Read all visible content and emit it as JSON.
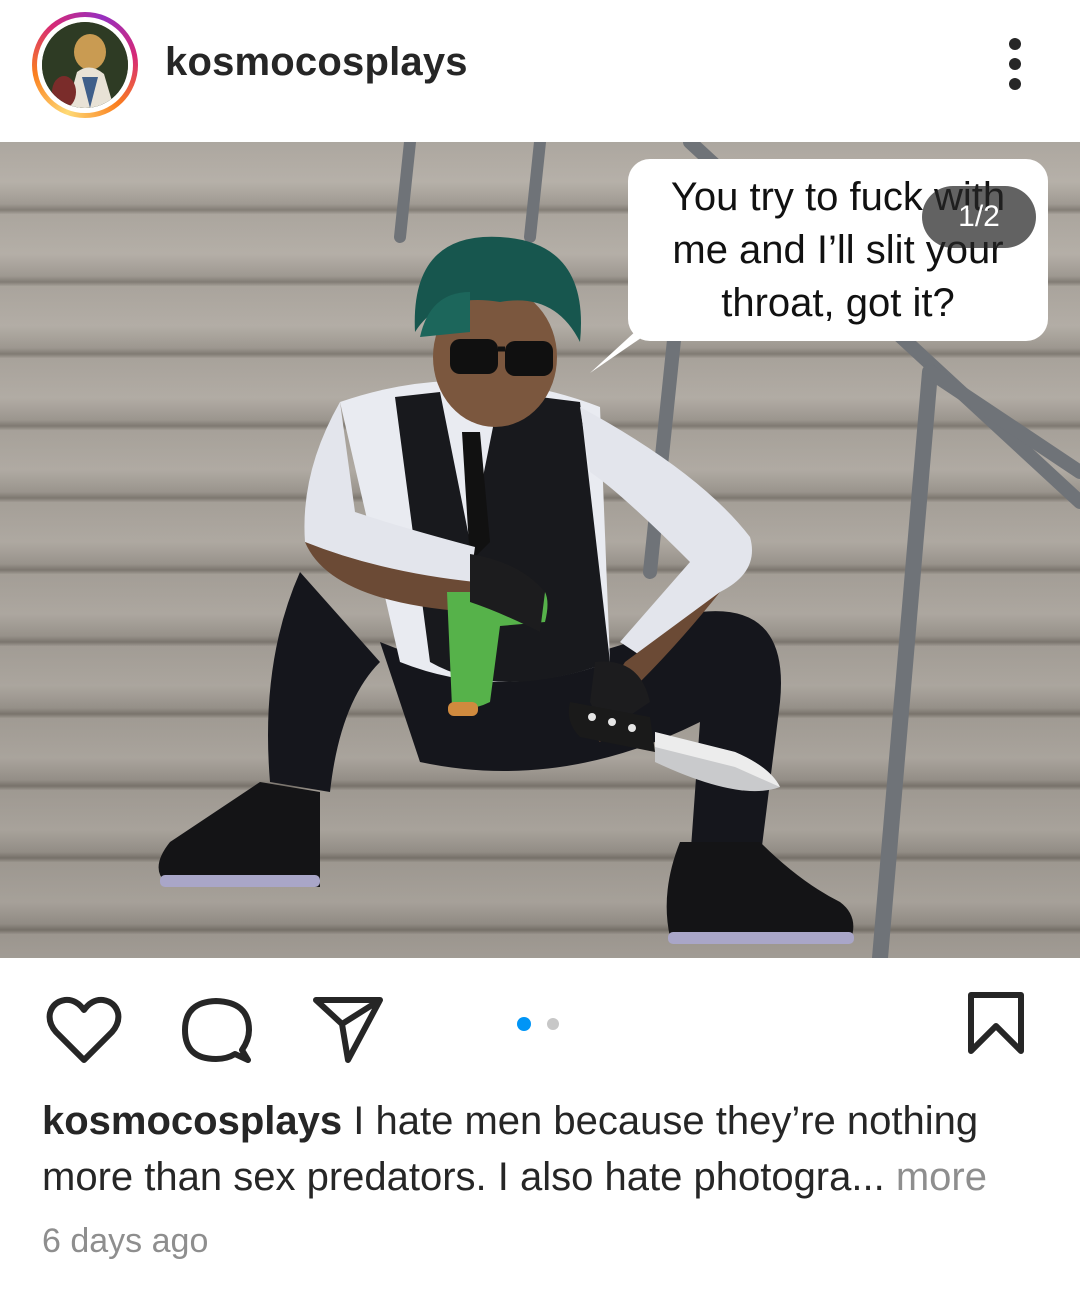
{
  "post": {
    "username": "kosmocosplays",
    "avatar_icon": "profile-avatar",
    "more_icon": "vertical-ellipsis-icon"
  },
  "media": {
    "speech_text": "You try to fuck with\nme and I’ll slit your\nthroat, got it?",
    "counter": "1/2",
    "slide_count": 2,
    "active_slide": 1
  },
  "actions": {
    "like_icon": "heart-icon",
    "comment_icon": "comment-icon",
    "share_icon": "paper-plane-icon",
    "save_icon": "bookmark-icon",
    "active_dot_color": "#0095f6",
    "inactive_dot_color": "#c7c7c7"
  },
  "caption": {
    "username": "kosmocosplays",
    "text": " I hate men because they’re nothing more than sex predators. I also hate photogra",
    "ellipsis": "...",
    "more_label": " more"
  },
  "timestamp": "6 days ago"
}
